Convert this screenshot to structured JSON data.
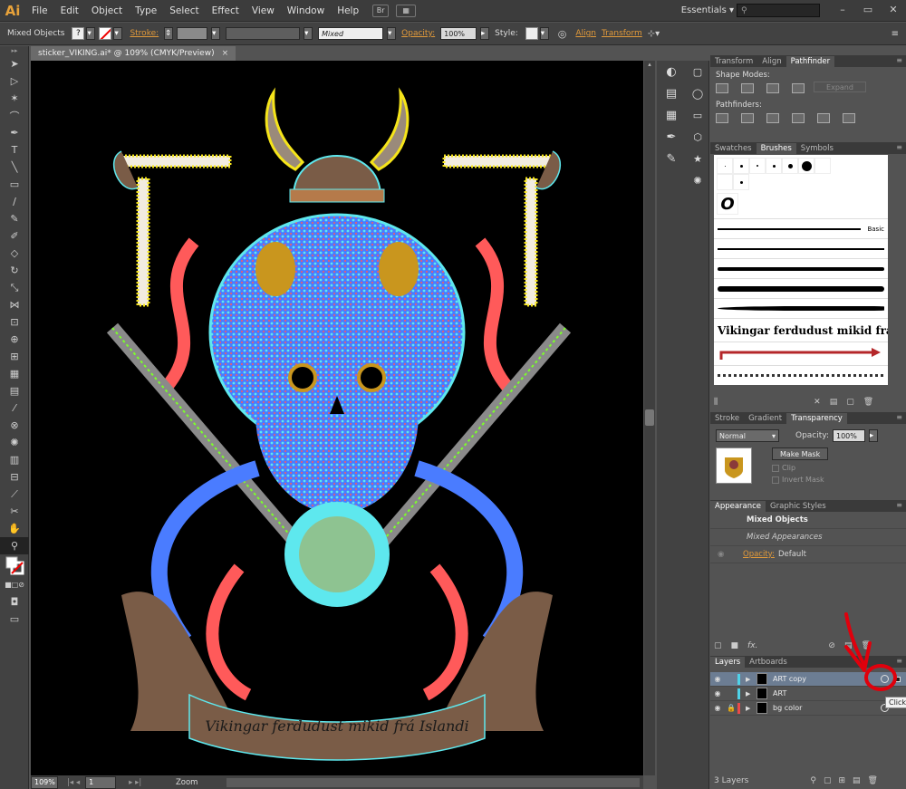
{
  "app": {
    "logo": "Ai"
  },
  "menu": [
    "File",
    "Edit",
    "Object",
    "Type",
    "Select",
    "Effect",
    "View",
    "Window",
    "Help"
  ],
  "menubar_btn": "Br",
  "workspace": "Essentials",
  "workspace_caret": "▾",
  "control_bar": {
    "selection": "Mixed Objects",
    "stroke_label": "Stroke:",
    "stroke_style": "Mixed",
    "opacity_label": "Opacity:",
    "opacity_value": "100%",
    "style_label": "Style:",
    "align_label": "Align",
    "transform_label": "Transform"
  },
  "document": {
    "tab": "sticker_VIKING.ai* @ 109% (CMYK/Preview)",
    "close": "×"
  },
  "artwork": {
    "banner_text": "Vikingar ferdudust mikid frá Islandi"
  },
  "status": {
    "zoom": "109%",
    "page": "1",
    "mode": "Zoom"
  },
  "panels": {
    "transform_tabs": [
      "Transform",
      "Align",
      "Pathfinder"
    ],
    "shape_modes_label": "Shape Modes:",
    "pathfinders_label": "Pathfinders:",
    "expand_label": "Expand",
    "brush_tabs": [
      "Swatches",
      "Brushes",
      "Symbols"
    ],
    "brush_basic_label": "Basic",
    "brush_text_sample": "Vikingar ferdudust mikid frá Íslandi",
    "transparency_tabs": [
      "Stroke",
      "Gradient",
      "Transparency"
    ],
    "blend_mode": "Normal",
    "opacity_label": "Opacity:",
    "opacity_value": "100%",
    "make_mask": "Make Mask",
    "clip_label": "Clip",
    "invert_mask_label": "Invert Mask",
    "appearance_tabs": [
      "Appearance",
      "Graphic Styles"
    ],
    "appearance_title": "Mixed Objects",
    "appearance_sub": "Mixed Appearances",
    "appearance_opacity_label": "Opacity:",
    "appearance_opacity_value": "Default",
    "appearance_fx": "fx.",
    "layers_tabs": [
      "Layers",
      "Artboards"
    ],
    "layers": [
      {
        "name": "ART copy",
        "color": "#4fd2e8",
        "selected": true,
        "locked": false
      },
      {
        "name": "ART",
        "color": "#4fd2e8",
        "selected": false,
        "locked": false
      },
      {
        "name": "bg color",
        "color": "#e84a4a",
        "selected": false,
        "locked": true
      }
    ],
    "layers_count": "3 Layers"
  },
  "annotation": {
    "click_label": "Click"
  },
  "colors": {
    "accent": "#e29a3a",
    "annotation_red": "#e0000c",
    "layer_sel": "#6c7d93"
  }
}
